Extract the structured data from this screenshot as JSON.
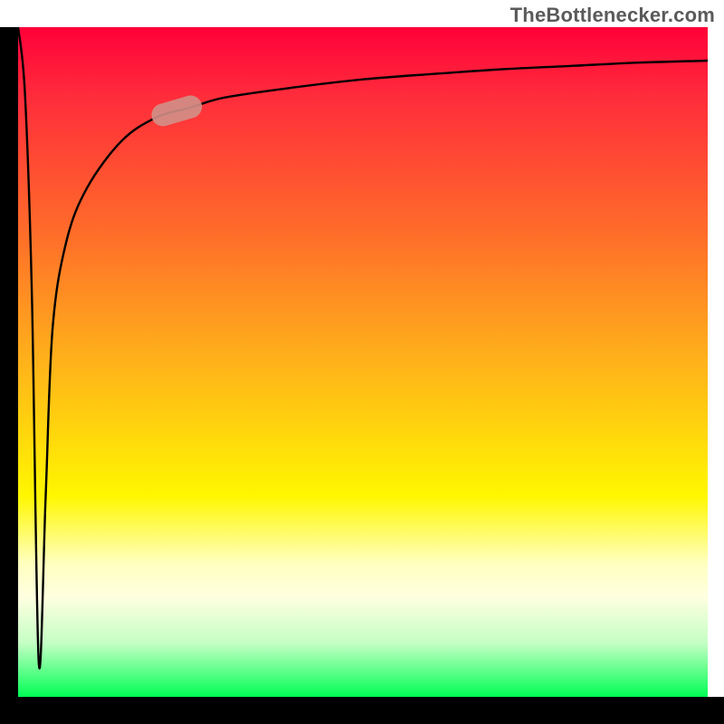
{
  "attribution": "TheBottlenecker.com",
  "colors": {
    "gradient_top": "#ff0039",
    "gradient_bottom": "#00ff54",
    "curve": "#000000",
    "marker": "#d29088",
    "axes": "#000000"
  },
  "chart_data": {
    "type": "line",
    "title": "",
    "xlabel": "",
    "ylabel": "",
    "xlim": [
      0,
      100
    ],
    "ylim": [
      0,
      100
    ],
    "x": [
      0,
      1,
      2,
      3,
      4,
      5,
      7,
      10,
      15,
      20,
      25,
      30,
      40,
      50,
      60,
      70,
      80,
      90,
      100
    ],
    "values": [
      100,
      90,
      60,
      5,
      30,
      55,
      68,
      76,
      83,
      86.5,
      88,
      89.5,
      91,
      92.2,
      93,
      93.7,
      94.2,
      94.7,
      95
    ],
    "annotations": [
      {
        "name": "marker",
        "x": 23,
        "y": 87.5,
        "shape": "pill",
        "color": "#d29088"
      }
    ],
    "grid": false,
    "legend": false
  }
}
